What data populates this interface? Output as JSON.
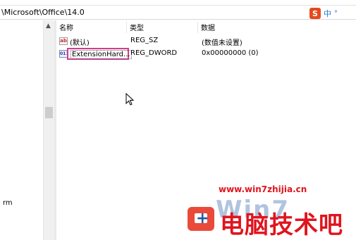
{
  "address": {
    "path": "\\Microsoft\\Office\\14.0"
  },
  "ime": {
    "logo": "S",
    "mode": "中",
    "extra": "°"
  },
  "tree": {
    "partial_label": "rm"
  },
  "columns": {
    "name": "名称",
    "type": "类型",
    "data": "数据"
  },
  "rows": [
    {
      "name": "(默认)",
      "type": "REG_SZ",
      "data": "(数值未设置)",
      "icon": "reg-sz-icon"
    },
    {
      "name": "ExtensionHard...",
      "type": "REG_DWORD",
      "data": "0x00000000 (0)",
      "icon": "reg-dword-icon"
    }
  ],
  "watermark": {
    "url": "www.win7zhijia.cn",
    "brand": "电脑技术吧",
    "win_text": "Win7"
  },
  "colors": {
    "highlight": "#d23c8e",
    "watermark_red": "#e0141e",
    "watermark_blue": "#1f5aa6"
  }
}
